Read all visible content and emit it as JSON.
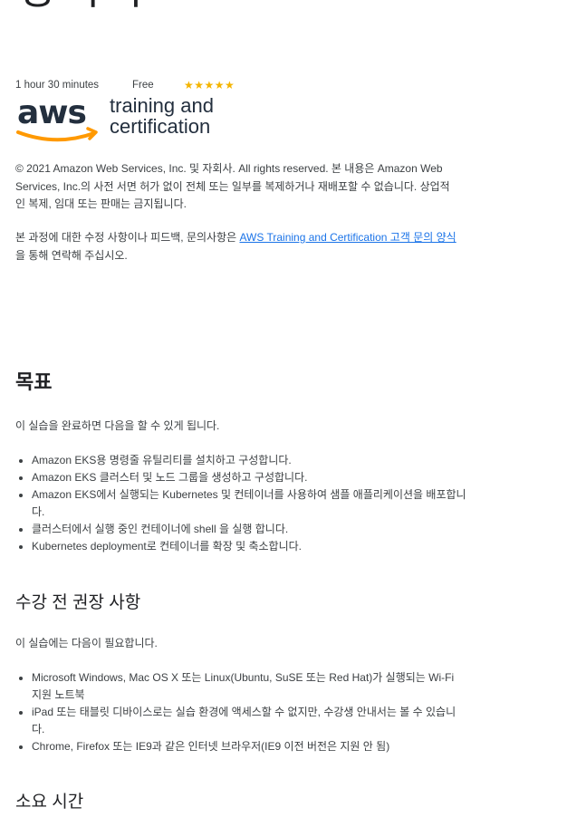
{
  "header": {
    "title": "강의목"
  },
  "meta": {
    "duration": "1 hour 30 minutes",
    "price": "Free",
    "rating_stars": "★★★★★",
    "rating_value": 5
  },
  "logo": {
    "wordmark": "aws",
    "line1": "training and",
    "line2": "certification",
    "accent_color": "#f90",
    "text_color": "#232f3e"
  },
  "copyright": {
    "text": "© 2021 Amazon Web Services, Inc. 및 자회사. All rights reserved. 본 내용은 Amazon Web Services, Inc.의 사전 서면 허가 없이 전체 또는 일부를 복제하거나 재배포할 수 없습니다. 상업적인 복제, 임대 또는 판매는 금지됩니다."
  },
  "feedback": {
    "prefix": "본 과정에 대한 수정 사항이나 피드백, 문의사항은 ",
    "link_text": "AWS Training and Certification 고객 문의 양식",
    "suffix": " 을 통해 연락해 주십시오."
  },
  "objectives": {
    "heading": "목표",
    "intro": "이 실습을 완료하면 다음을 할 수 있게 됩니다.",
    "items": [
      "Amazon EKS용 명령줄 유틸리티를 설치하고 구성합니다.",
      "Amazon EKS 클러스터 및 노드 그룹을 생성하고 구성합니다.",
      "Amazon EKS에서 실행되는 Kubernetes 및 컨테이너를 사용하여 샘플 애플리케이션을 배포합니다.",
      "클러스터에서 실행 중인 컨테이너에 shell 을 실행 합니다.",
      "Kubernetes deployment로 컨테이너를 확장 및 축소합니다."
    ]
  },
  "prerequisites": {
    "heading": "수강 전 권장 사항",
    "intro": "이 실습에는 다음이 필요합니다.",
    "items": [
      "Microsoft Windows, Mac OS X 또는 Linux(Ubuntu, SuSE 또는 Red Hat)가 실행되는 Wi-Fi 지원 노트북",
      "iPad 또는 태블릿 디바이스로는 실습 환경에 액세스할 수 없지만, 수강생 안내서는 볼 수 있습니다.",
      "Chrome, Firefox 또는 IE9과 같은 인터넷 브라우저(IE9 이전 버전은 지원 안 됨)"
    ]
  },
  "duration_section": {
    "heading": "소요 시간"
  }
}
